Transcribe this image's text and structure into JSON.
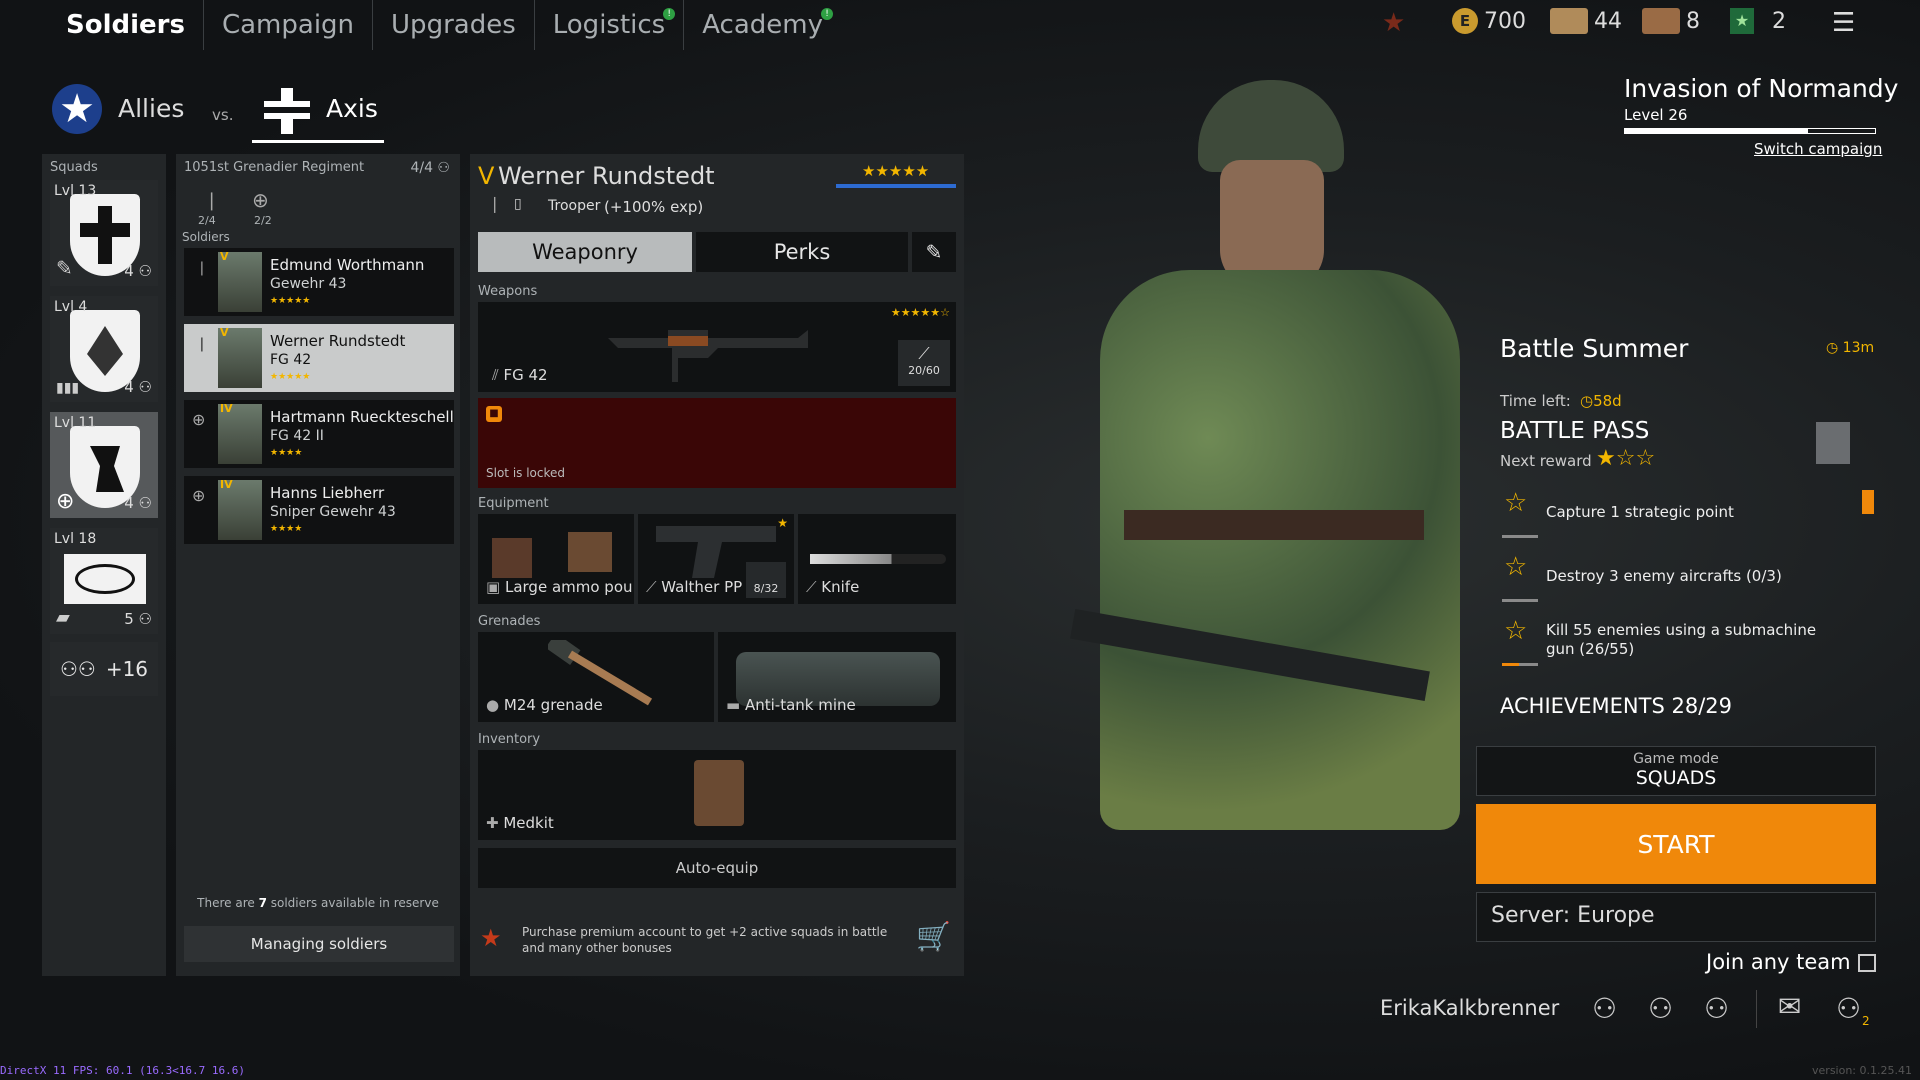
{
  "nav": {
    "tabs": [
      {
        "label": "Soldiers",
        "active": true
      },
      {
        "label": "Campaign"
      },
      {
        "label": "Upgrades"
      },
      {
        "label": "Logistics",
        "badge": "!"
      },
      {
        "label": "Academy",
        "badge": "!"
      }
    ]
  },
  "resources": {
    "silver": "700",
    "orders": "44",
    "tickets": "8",
    "premium": "2"
  },
  "factions": {
    "allies": "Allies",
    "vs": "vs.",
    "axis": "Axis"
  },
  "squads": {
    "title": "Squads",
    "items": [
      {
        "level": "Lvl 13",
        "count": "4"
      },
      {
        "level": "Lvl 4",
        "count": "4"
      },
      {
        "level": "Lvl 11",
        "count": "4"
      },
      {
        "level": "Lvl 18",
        "count": "5"
      }
    ],
    "reserve": "+16"
  },
  "squad_detail": {
    "title": "1051st Grenadier Regiment",
    "capacity": "4/4",
    "slots1": "2/4",
    "slots2": "2/2",
    "soldiers_label": "Soldiers",
    "soldiers": [
      {
        "rank": "V",
        "name": "Edmund Worthmann",
        "weapon": "Gewehr 43"
      },
      {
        "rank": "V",
        "name": "Werner Rundstedt",
        "weapon": "FG 42"
      },
      {
        "rank": "IV",
        "name": "Hartmann Rueckteschell",
        "weapon": "FG 42 II"
      },
      {
        "rank": "IV",
        "name": "Hanns Liebherr",
        "weapon": "Sniper Gewehr 43"
      }
    ],
    "reserve_pre": "There are ",
    "reserve_num": "7",
    "reserve_post": " soldiers available in reserve",
    "manage": "Managing soldiers"
  },
  "soldier": {
    "rank": "V",
    "name": "Werner Rundstedt",
    "class": "Trooper",
    "bonus": "(+100% exp)",
    "tab_weaponry": "Weaponry",
    "tab_perks": "Perks",
    "weapons_label": "Weapons",
    "weapon": "FG 42",
    "ammo": "20/60",
    "locked": "Slot is locked",
    "equipment_label": "Equipment",
    "eq1": "Large ammo pou",
    "eq2": "Walther PP",
    "eq2_ammo": "8/32",
    "eq3": "Knife",
    "grenades_label": "Grenades",
    "gr1": "M24 grenade",
    "gr2": "Anti-tank mine",
    "inventory_label": "Inventory",
    "inv1": "Medkit",
    "auto": "Auto-equip",
    "premium": "Purchase premium account to get +2 active squads in battle and many other bonuses"
  },
  "campaign": {
    "name": "Invasion of Normandy",
    "level": "Level 26",
    "progress": 0.73,
    "switch": "Switch campaign"
  },
  "battle": {
    "title": "Battle Summer",
    "timer": "13m",
    "time_left_label": "Time left:",
    "time_left": "58d",
    "pass": "BATTLE PASS",
    "next_reward": "Next reward",
    "quests": [
      {
        "text": "Capture 1 strategic point",
        "progress": 0
      },
      {
        "text": "Destroy 3 enemy aircrafts (0/3)",
        "progress": 0
      },
      {
        "text": "Kill 55 enemies using a submachine gun (26/55)",
        "progress": 0.47
      }
    ],
    "achievements": "ACHIEVEMENTS 28/29"
  },
  "play": {
    "mode_label": "Game mode",
    "mode": "SQUADS",
    "start": "START",
    "server": "Server: Europe",
    "join": "Join any team"
  },
  "user": {
    "name": "ErikaKalkbrenner",
    "group_count": "2"
  },
  "footer": {
    "fps": "DirectX 11 FPS: 60.1 (16.3<16.7 16.6)",
    "version": "version: 0.1.25.41"
  },
  "colors": {
    "accent": "#f0880a",
    "gold": "#f2b600",
    "locked": "#3a0606"
  }
}
